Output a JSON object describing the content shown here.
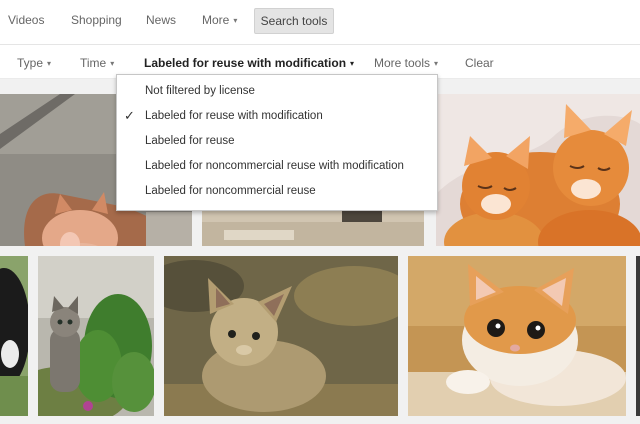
{
  "nav": {
    "items": [
      "Videos",
      "Shopping",
      "News",
      "More"
    ],
    "search_tools": "Search tools"
  },
  "tools": {
    "type": "Type",
    "time": "Time",
    "usage_rights": "Labeled for reuse with modification",
    "more_tools": "More tools",
    "clear": "Clear"
  },
  "license_menu": {
    "selected_index": 1,
    "options": [
      "Not filtered by license",
      "Labeled for reuse with modification",
      "Labeled for reuse",
      "Labeled for noncommercial reuse with modification",
      "Labeled for noncommercial reuse"
    ]
  },
  "colors": {
    "menu_border": "#c6c6c6",
    "button_bg": "#e4e4e4",
    "page_bg": "#f1f1f1"
  },
  "icons": {
    "caret": "▾",
    "check": "✓"
  },
  "images": [
    {
      "subject": "kitten held in hand"
    },
    {
      "subject": "kitten"
    },
    {
      "subject": "two orange kittens sleeping"
    },
    {
      "subject": "black and white kitten"
    },
    {
      "subject": "tabby kitten in garden"
    },
    {
      "subject": "sand kitten"
    },
    {
      "subject": "orange and white kitten lying down"
    },
    {
      "subject": "partial image"
    }
  ]
}
